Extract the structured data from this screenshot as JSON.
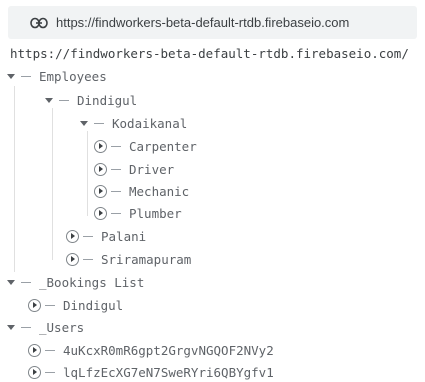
{
  "header": {
    "url": "https://findworkers-beta-default-rtdb.firebaseio.com",
    "link_icon": "link-icon"
  },
  "root_url": "https://findworkers-beta-default-rtdb.firebaseio.com/",
  "tree": {
    "employees": "Employees",
    "dindigul": "Dindigul",
    "kodaikanal": "Kodaikanal",
    "carpenter": "Carpenter",
    "driver": "Driver",
    "mechanic": "Mechanic",
    "plumber": "Plumber",
    "palani": "Palani",
    "sriramapuram": "Sriramapuram",
    "bookings": "_Bookings List",
    "bookings_dindigul": "Dindigul",
    "users": "_Users",
    "user1": "4uKcxR0mR6gpt2GrgvNGQOF2NVy2",
    "user2": "lqLfzEcXG7eN7SweRYri6QBYgfv1"
  }
}
